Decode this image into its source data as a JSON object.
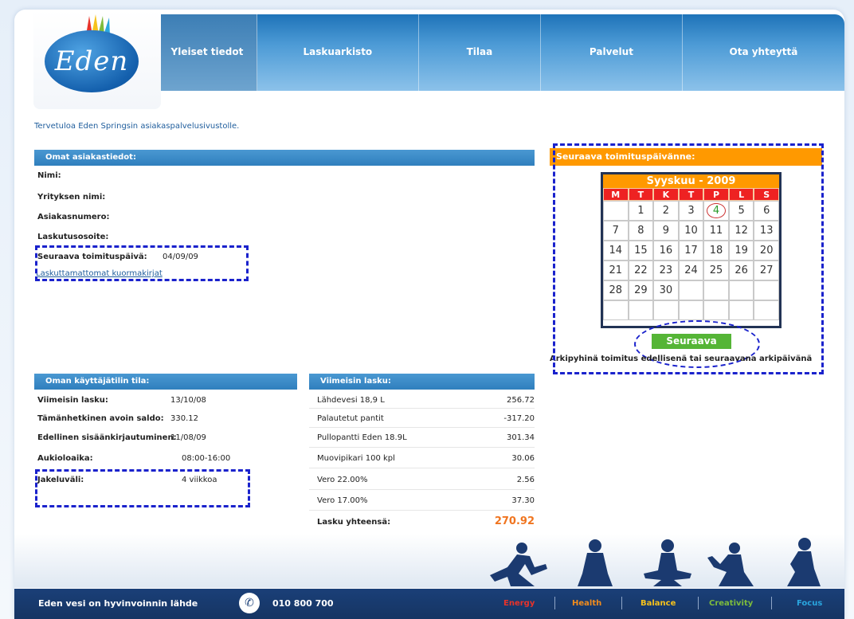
{
  "header": {
    "logo_text": "Eden",
    "nav": [
      {
        "label": "Yleiset tiedot",
        "active": true
      },
      {
        "label": "Laskuarkisto",
        "active": false
      },
      {
        "label": "Tilaa",
        "active": false
      },
      {
        "label": "Palvelut",
        "active": false
      },
      {
        "label": "Ota yhteyttä",
        "active": false
      }
    ]
  },
  "welcome": "Tervetuloa Eden Springsin asiakaspalvelusivustolle.",
  "customer": {
    "title": "Omat asiakastiedot:",
    "name_label": "Nimi:",
    "company_label": "Yrityksen nimi:",
    "customer_number_label": "Asiakasnumero:",
    "billing_address_label": "Laskutusosoite:",
    "next_delivery_label": "Seuraava toimituspäivä:",
    "next_delivery_value": "04/09/09",
    "unbilled_link": "Laskuttamattomat kuormakirjat"
  },
  "account": {
    "title": "Oman käyttäjätilin tila:",
    "rows": [
      {
        "label": "Viimeisin lasku:",
        "value": "13/10/08"
      },
      {
        "label": "Tämänhetkinen avoin saldo:",
        "value": "330.12"
      },
      {
        "label": "Edellinen sisäänkirjautuminen:",
        "value": "11/08/09"
      },
      {
        "label": "Aukioloaika:",
        "value": "08:00-16:00"
      },
      {
        "label": "Jakeluväli:",
        "value": "4 viikkoa"
      }
    ]
  },
  "invoice": {
    "title": "Viimeisin lasku:",
    "rows": [
      {
        "label": "Lähdevesi 18,9 L",
        "value": "256.72"
      },
      {
        "label": "Palautetut pantit",
        "value": "-317.20"
      },
      {
        "label": "Pullopantti Eden 18.9L",
        "value": "301.34"
      },
      {
        "label": "Muovipikari 100 kpl",
        "value": "30.06"
      },
      {
        "label": "Vero 22.00%",
        "value": "2.56"
      },
      {
        "label": "Vero 17.00%",
        "value": "37.30"
      }
    ],
    "total_label": "Lasku yhteensä:",
    "total_value": "270.92"
  },
  "delivery": {
    "title": "Seuraava toimituspäivänne:",
    "calendar": {
      "month_label": "Syyskuu - 2009",
      "weekdays": [
        "M",
        "T",
        "K",
        "T",
        "P",
        "L",
        "S"
      ],
      "days": [
        "",
        "1",
        "2",
        "3",
        "4",
        "5",
        "6",
        "7",
        "8",
        "9",
        "10",
        "11",
        "12",
        "13",
        "14",
        "15",
        "16",
        "17",
        "18",
        "19",
        "20",
        "21",
        "22",
        "23",
        "24",
        "25",
        "26",
        "27",
        "28",
        "29",
        "30",
        "",
        "",
        "",
        "",
        "",
        "",
        "",
        "",
        "",
        "",
        ""
      ],
      "highlight_day": "4"
    },
    "next_button": "Seuraava",
    "note": "Arkipyhinä toimitus edellisenä tai seuraavana arkipäivänä"
  },
  "footer": {
    "slogan": "Eden vesi on hyvinvoinnin lähde",
    "phone": "010 800 700",
    "words": [
      {
        "label": "Energy",
        "color": "#e8332a"
      },
      {
        "label": "Health",
        "color": "#f28c1c"
      },
      {
        "label": "Balance",
        "color": "#f6c21c"
      },
      {
        "label": "Creativity",
        "color": "#7dbb3c"
      },
      {
        "label": "Focus",
        "color": "#2aa6df"
      }
    ]
  }
}
